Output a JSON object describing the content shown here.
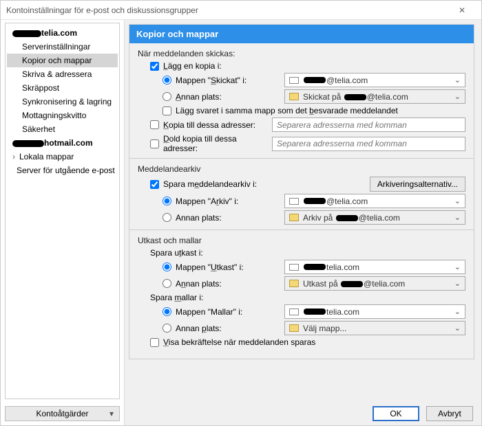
{
  "window": {
    "title": "Kontoinställningar för e-post och diskussionsgrupper"
  },
  "sidebar": {
    "items": [
      {
        "label": "telia.com",
        "kind": "account-top",
        "redacted_prefix": true
      },
      {
        "label": "Serverinställningar",
        "kind": "sub"
      },
      {
        "label": "Kopior och mappar",
        "kind": "sub",
        "selected": true
      },
      {
        "label": "Skriva & adressera",
        "kind": "sub"
      },
      {
        "label": "Skräppost",
        "kind": "sub"
      },
      {
        "label": "Synkronisering & lagring",
        "kind": "sub"
      },
      {
        "label": "Mottagningskvitto",
        "kind": "sub"
      },
      {
        "label": "Säkerhet",
        "kind": "sub"
      },
      {
        "label": "hotmail.com",
        "kind": "account-top",
        "redacted_prefix": true
      },
      {
        "label": "Lokala mappar",
        "kind": "caret"
      },
      {
        "label": "Server för utgående e-post",
        "kind": "plain"
      }
    ],
    "account_actions_label": "Kontoåtgärder"
  },
  "header": {
    "title": "Kopior och mappar"
  },
  "send": {
    "title": "När meddelanden skickas:",
    "place_copy_label": "Lägg en kopia i:",
    "folder_label_prefix": "Mappen \"Skickat\" i:",
    "account_suffix": "@telia.com",
    "other_label": "Annan plats:",
    "other_value_prefix": "Skickat på",
    "reply_same_folder": "Lägg svaret i samma mapp som det besvarade meddelandet",
    "cc_label": "Kopia till dessa adresser:",
    "bcc_label": "Dold kopia till dessa adresser:",
    "placeholder": "Separera adresserna med komman"
  },
  "archive": {
    "title": "Meddelandearkiv",
    "keep_label": "Spara meddelandearkiv i:",
    "options_btn": "Arkiveringsalternativ...",
    "folder_label": "Mappen \"Arkiv\" i:",
    "account_suffix": "@telia.com",
    "other_label": "Annan plats:",
    "other_value_prefix": "Arkiv på",
    "other_value_suffix": "@telia.com"
  },
  "drafts": {
    "title": "Utkast och mallar",
    "drafts_label": "Spara utkast i:",
    "drafts_folder_label": "Mappen \"Utkast\" i:",
    "account_suffix": "telia.com",
    "other_label": "Annan plats:",
    "drafts_other_prefix": "Utkast på",
    "drafts_other_suffix": "@telia.com",
    "templates_label": "Spara mallar i:",
    "templates_folder_label": "Mappen \"Mallar\" i:",
    "templates_other_value": "Välj mapp...",
    "confirm_label": "Visa bekräftelse när meddelanden sparas"
  },
  "footer": {
    "ok": "OK",
    "cancel": "Avbryt"
  }
}
